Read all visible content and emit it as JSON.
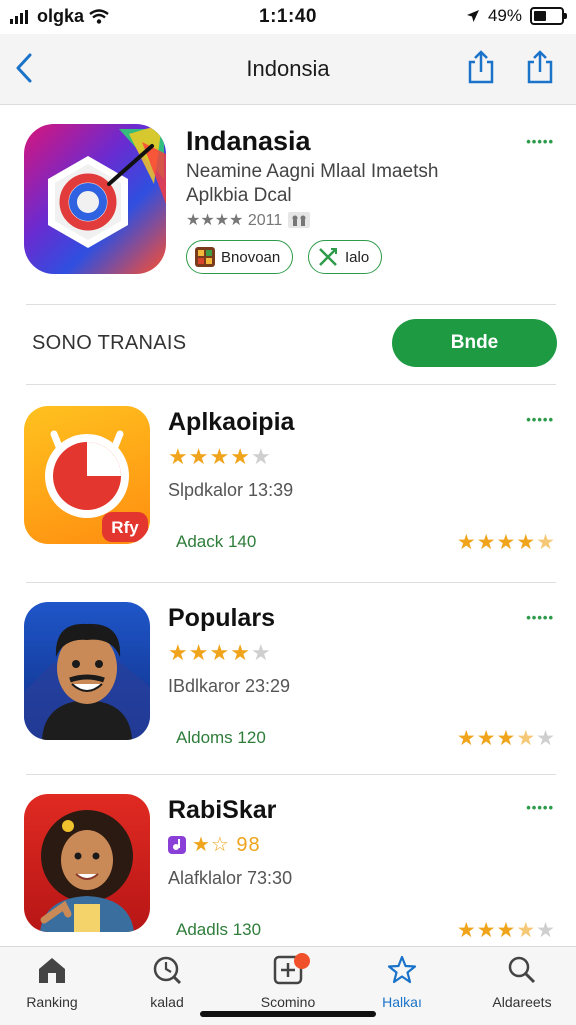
{
  "status": {
    "carrier": "olgka",
    "time": "1:1:40",
    "battery": "49%",
    "battery_level": 0.49
  },
  "nav": {
    "title": "Indonsia"
  },
  "hero": {
    "title": "Indanasia",
    "subtitle_line1": "Neamine Aagni  Mlaal Imaetsh",
    "subtitle_line2": "Aplkbia Dcal",
    "rating_text": "★★★★ 2011",
    "chip1_label": "Bnovoan",
    "chip2_label": "Ialo",
    "more": "•••••"
  },
  "section": {
    "label": "SONO TRANAIS",
    "button_label": "Bnde"
  },
  "apps": [
    {
      "title": "Aplkaoipia",
      "stars": 4,
      "meta": "Slpdkalor 13:39",
      "count": "Adack 140",
      "right_stars": 4.5,
      "icon_badge": "Rfy",
      "more": "•••••"
    },
    {
      "title": "Populars",
      "stars": 4,
      "meta": "IBdlkaror 23:29",
      "count": "Aldoms 120",
      "right_stars": 3.5,
      "more": "•••••"
    },
    {
      "title": "RabiSkar",
      "stars_text": "★☆ 98",
      "meta": "Alafklalor 73:30",
      "count": "Adadls 130",
      "right_stars": 3.5,
      "more": "•••••"
    }
  ],
  "tabs": [
    {
      "label": "Ranking",
      "icon": "house-icon"
    },
    {
      "label": "kalad",
      "icon": "clock-search-icon"
    },
    {
      "label": "Scomino",
      "icon": "plus-square-icon"
    },
    {
      "label": "Halkaı",
      "icon": "star-icon",
      "active": true
    },
    {
      "label": "Aldareets",
      "icon": "search-icon"
    }
  ],
  "colors": {
    "accent_blue": "#1a73c9",
    "green": "#1e9a43",
    "star": "#f0a41c"
  }
}
